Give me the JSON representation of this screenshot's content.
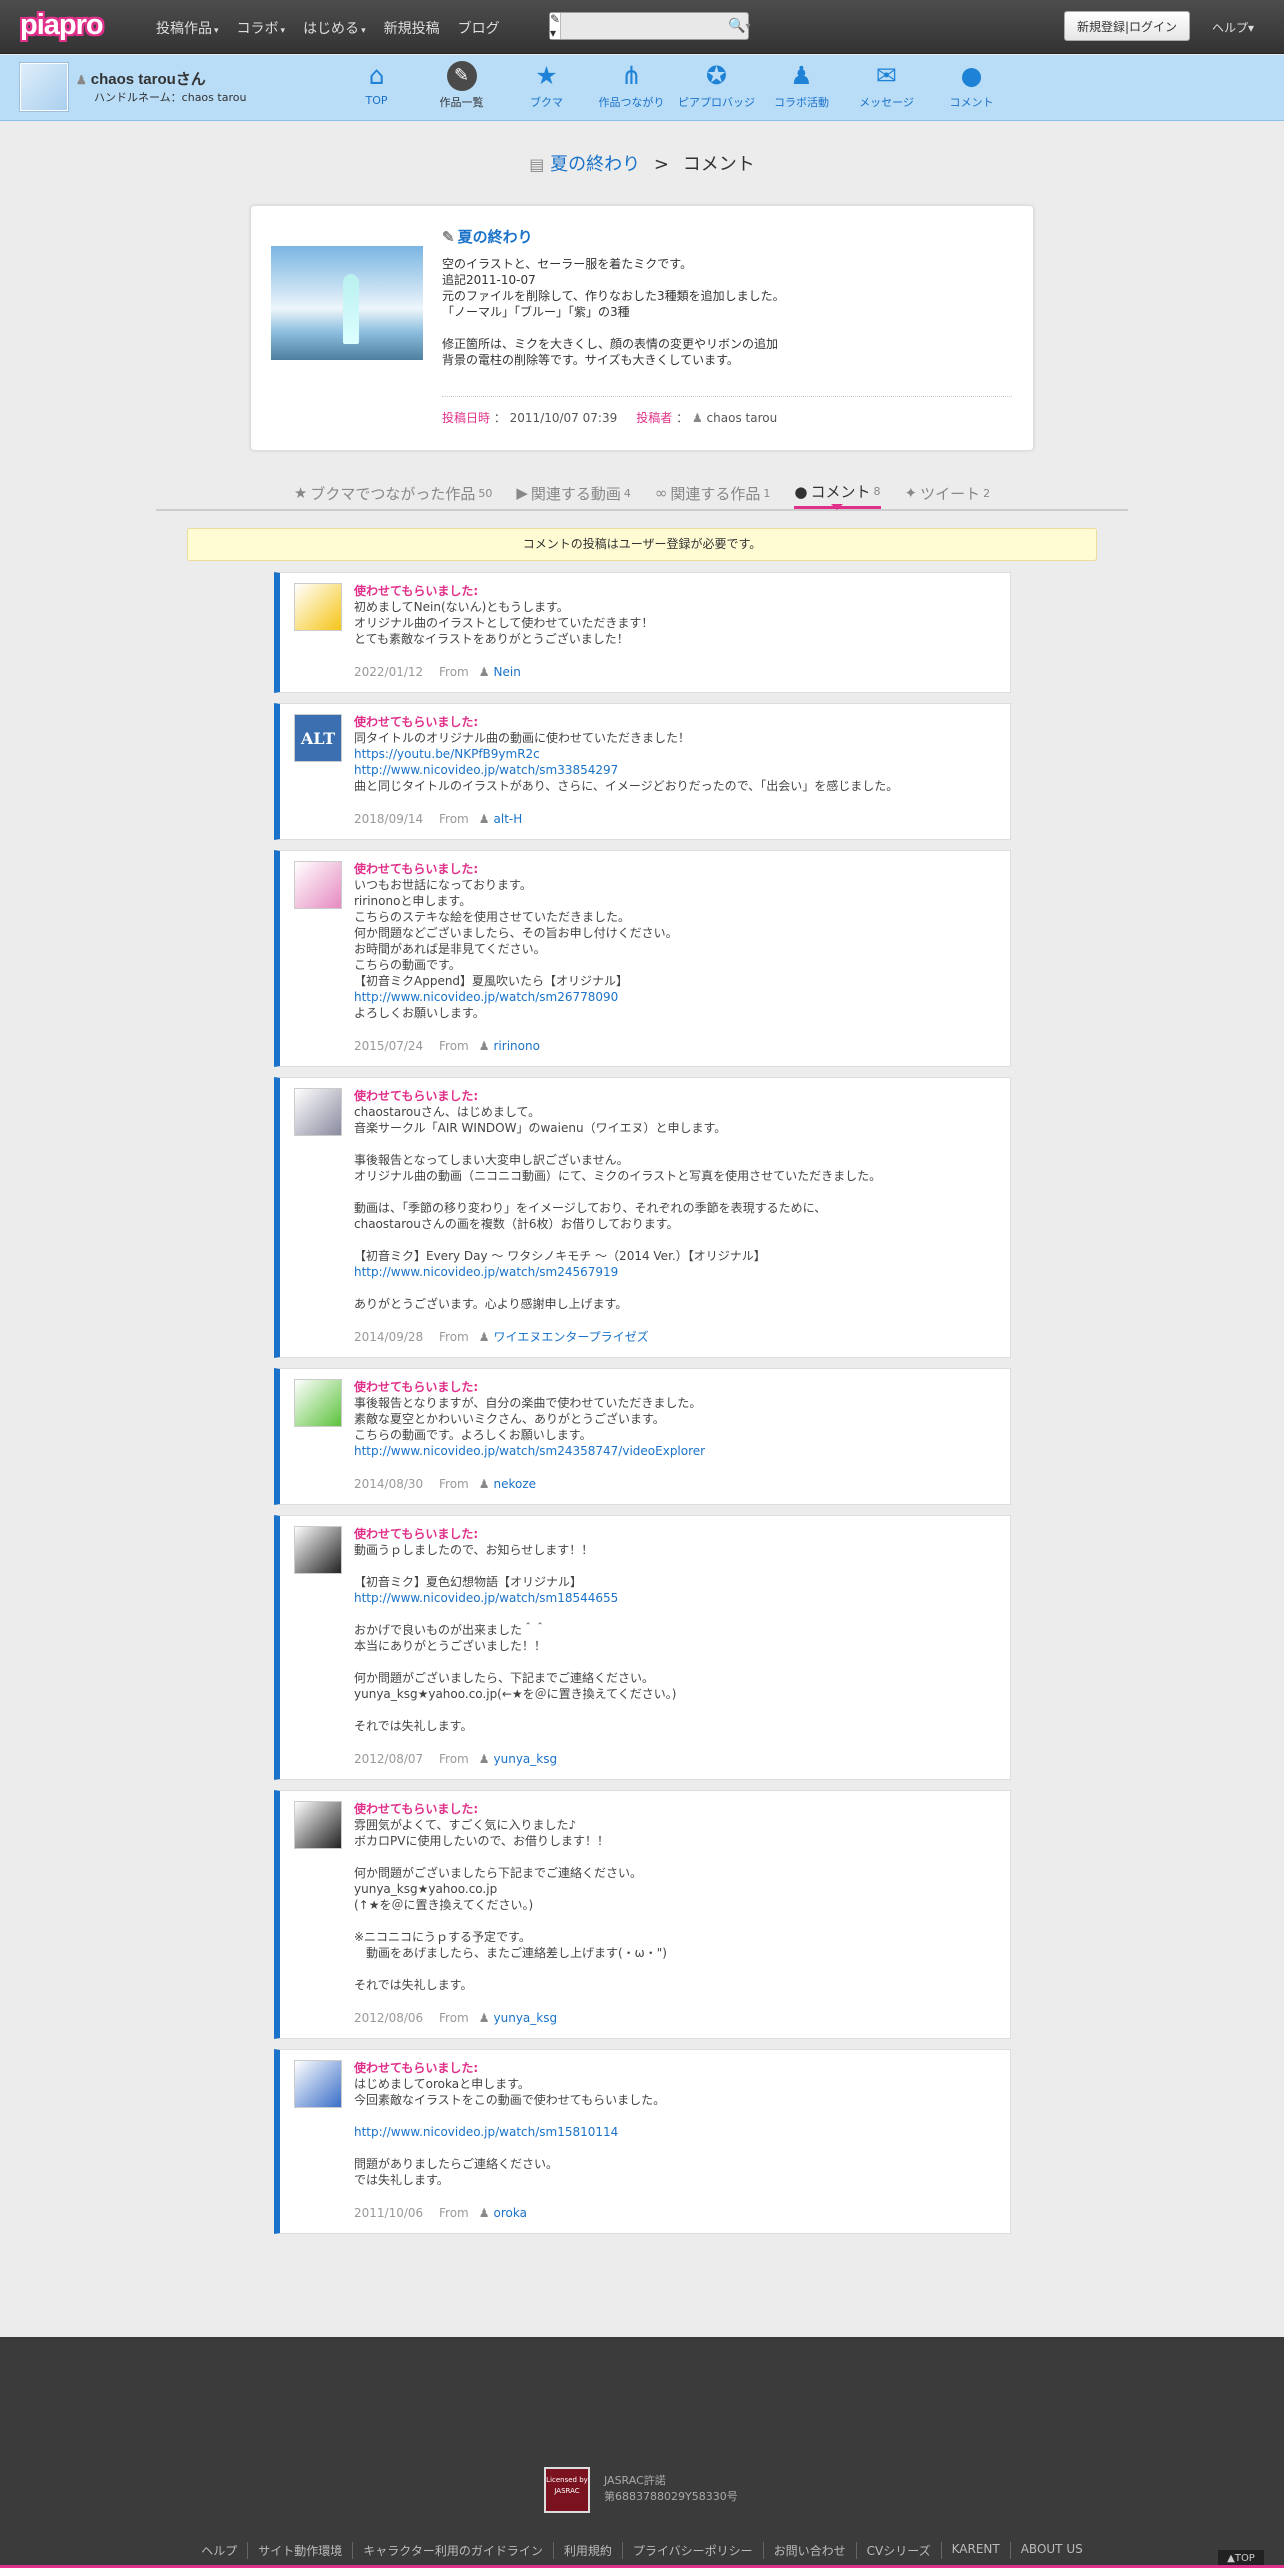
{
  "header": {
    "logo": "piapro",
    "nav": [
      {
        "label": "投稿作品",
        "caret": true
      },
      {
        "label": "コラボ",
        "caret": true
      },
      {
        "label": "はじめる",
        "caret": true
      },
      {
        "label": "新規投稿",
        "caret": false
      },
      {
        "label": "ブログ",
        "caret": false
      }
    ],
    "search_select": "✎ ▾",
    "search_placeholder": "",
    "login_label": "新規登録|ログイン",
    "help_label": "ヘルプ▾"
  },
  "user": {
    "name": "chaos tarouさん",
    "handle": "ハンドルネーム：chaos tarou",
    "nav": [
      {
        "label": "TOP",
        "icon": "home-icon",
        "glyph": "⌂"
      },
      {
        "label": "作品一覧",
        "icon": "works-icon",
        "glyph": "✎",
        "active": true
      },
      {
        "label": "ブクマ",
        "icon": "bookmark-icon",
        "glyph": "★"
      },
      {
        "label": "作品つながり",
        "icon": "share-icon",
        "glyph": "⋔"
      },
      {
        "label": "ピアプロバッジ",
        "icon": "badge-icon",
        "glyph": "✪"
      },
      {
        "label": "コラボ活動",
        "icon": "collab-icon",
        "glyph": "♟"
      },
      {
        "label": "メッセージ",
        "icon": "mail-icon",
        "glyph": "✉"
      },
      {
        "label": "コメント",
        "icon": "comment-icon",
        "glyph": "●"
      }
    ]
  },
  "breadcrumb": {
    "work": "夏の終わり",
    "sep": ">",
    "current": "コメント"
  },
  "work": {
    "title": "夏の終わり",
    "description": [
      "空のイラストと、セーラー服を着たミクです。",
      "追記2011-10-07",
      "元のファイルを削除して、作りなおした3種類を追加しました。",
      "「ノーマル」「ブルー」「紫」の3種",
      "",
      "修正箇所は、ミクを大きくし、顔の表情の変更やリボンの追加",
      "背景の電柱の削除等です。サイズも大きくしています。"
    ],
    "posted_label": "投稿日時",
    "posted_value": "2011/10/07 07:39",
    "poster_label": "投稿者",
    "poster_value": "chaos tarou"
  },
  "tabs": [
    {
      "label": "ブクマでつながった作品",
      "count": "50",
      "icon": "star-icon",
      "glyph": "★"
    },
    {
      "label": "関連する動画",
      "count": "4",
      "icon": "video-icon",
      "glyph": "▶"
    },
    {
      "label": "関連する作品",
      "count": "1",
      "icon": "link-icon",
      "glyph": "∞"
    },
    {
      "label": "コメント",
      "count": "8",
      "icon": "comment-icon",
      "glyph": "●",
      "active": true
    },
    {
      "label": "ツイート",
      "count": "2",
      "icon": "twitter-icon",
      "glyph": "✦"
    }
  ],
  "notice": "コメントの投稿はユーザー登録が必要です。",
  "comments": [
    {
      "title": "使わせてもらいました:",
      "lines": [
        "初めましてNein(ないん)ともうします。",
        "オリジナル曲のイラストとして使わせていただきます！",
        "とても素敵なイラストをありがとうございました！"
      ],
      "links": [],
      "date": "2022/01/12",
      "from": "From",
      "user": "Nein",
      "avatar_color": "#f5c518"
    },
    {
      "title": "使わせてもらいました:",
      "lines": [
        "同タイトルのオリジナル曲の動画に使わせていただきました！",
        "@https://youtu.be/NKPfB9ymR2c",
        "@http://www.nicovideo.jp/watch/sm33854297",
        "曲と同じタイトルのイラストがあり、さらに、イメージどおりだったので、「出会い」を感じました。"
      ],
      "date": "2018/09/14",
      "from": "From",
      "user": "alt-H",
      "avatar_color": "#3b6fb0",
      "avatar_text": "ALT"
    },
    {
      "title": "使わせてもらいました:",
      "lines": [
        "いつもお世話になっております。",
        "ririnonoと申します。",
        "こちらのステキな絵を使用させていただきました。",
        "何か問題などございましたら、その旨お申し付けください。",
        "お時間があれば是非見てください。",
        "こちらの動画です。",
        "【初音ミクAppend】夏風吹いたら【オリジナル】",
        "@http://www.nicovideo.jp/watch/sm26778090",
        "よろしくお願いします。"
      ],
      "date": "2015/07/24",
      "from": "From",
      "user": "ririnono",
      "avatar_color": "#e68ac0"
    },
    {
      "title": "使わせてもらいました:",
      "lines": [
        "chaostarouさん、はじめまして。",
        "音楽サークル「AIR WINDOW」のwaienu（ワイエヌ）と申します。",
        "",
        "事後報告となってしまい大変申し訳ございません。",
        "オリジナル曲の動画（ニコニコ動画）にて、ミクのイラストと写真を使用させていただきました。",
        "",
        "動画は、「季節の移り変わり」をイメージしており、それぞれの季節を表現するために、",
        "chaostarouさんの画を複数（計6枚）お借りしております。",
        "",
        "【初音ミク】Every Day ～ ワタシノキモチ ～（2014 Ver.）【オリジナル】",
        "@http://www.nicovideo.jp/watch/sm24567919",
        "",
        "ありがとうございます。心より感謝申し上げます。"
      ],
      "date": "2014/09/28",
      "from": "From",
      "user": "ワイエヌエンタープライゼズ",
      "avatar_color": "#8a8aa0"
    },
    {
      "title": "使わせてもらいました:",
      "lines": [
        "事後報告となりますが、自分の楽曲で使わせていただきました。",
        "素敵な夏空とかわいいミクさん、ありがとうございます。",
        "こちらの動画です。よろしくお願いします。",
        "@http://www.nicovideo.jp/watch/sm24358747/videoExplorer"
      ],
      "date": "2014/08/30",
      "from": "From",
      "user": "nekoze",
      "avatar_color": "#5cc23c"
    },
    {
      "title": "使わせてもらいました:",
      "lines": [
        "動画うｐしましたので、お知らせします！！",
        "",
        "【初音ミク】夏色幻想物語【オリジナル】",
        "@http://www.nicovideo.jp/watch/sm18544655",
        "",
        "おかげで良いものが出来ました＾＾",
        "本当にありがとうございました！！",
        "",
        "何か問題がございましたら、下記までご連絡ください。",
        "yunya_ksg★yahoo.co.jp(←★を＠に置き換えてください。)",
        "",
        "それでは失礼します。"
      ],
      "date": "2012/08/07",
      "from": "From",
      "user": "yunya_ksg",
      "avatar_color": "#222222"
    },
    {
      "title": "使わせてもらいました:",
      "lines": [
        "雰囲気がよくて、すごく気に入りました♪",
        "ボカロPVに使用したいので、お借りします！！",
        "",
        "何か問題がございましたら下記までご連絡ください。",
        "yunya_ksg★yahoo.co.jp",
        "(↑★を＠に置き換えてください。)",
        "",
        "※ニコニコにうｐする予定です。",
        "　動画をあげましたら、またご連絡差し上げます(・ω・\")",
        "",
        "それでは失礼します。"
      ],
      "date": "2012/08/06",
      "from": "From",
      "user": "yunya_ksg",
      "avatar_color": "#222222"
    },
    {
      "title": "使わせてもらいました:",
      "lines": [
        "はじめましてorokaと申します。",
        "今回素敵なイラストをこの動画で使わせてもらいました。",
        "",
        "@http://www.nicovideo.jp/watch/sm15810114",
        "",
        "問題がありましたらご連絡ください。",
        "では失礼します。"
      ],
      "date": "2011/10/06",
      "from": "From",
      "user": "oroka",
      "avatar_color": "#3a6ec8"
    }
  ],
  "footer": {
    "jasrac_logo": "Licensed by JASRAC",
    "jasrac_lines": [
      "JASRAC許諾",
      "第6883788029Y58330号"
    ],
    "links": [
      "ヘルプ",
      "サイト動作環境",
      "キャラクター利用のガイドライン",
      "利用規約",
      "プライバシーポリシー",
      "お問い合わせ",
      "CVシリーズ",
      "KARENT",
      "ABOUT US"
    ],
    "pagetop": "▲TOP"
  },
  "colors": {
    "accent_pink": "#e0308a",
    "link_blue": "#1a72c9",
    "userbar": "#b9dcf7"
  }
}
